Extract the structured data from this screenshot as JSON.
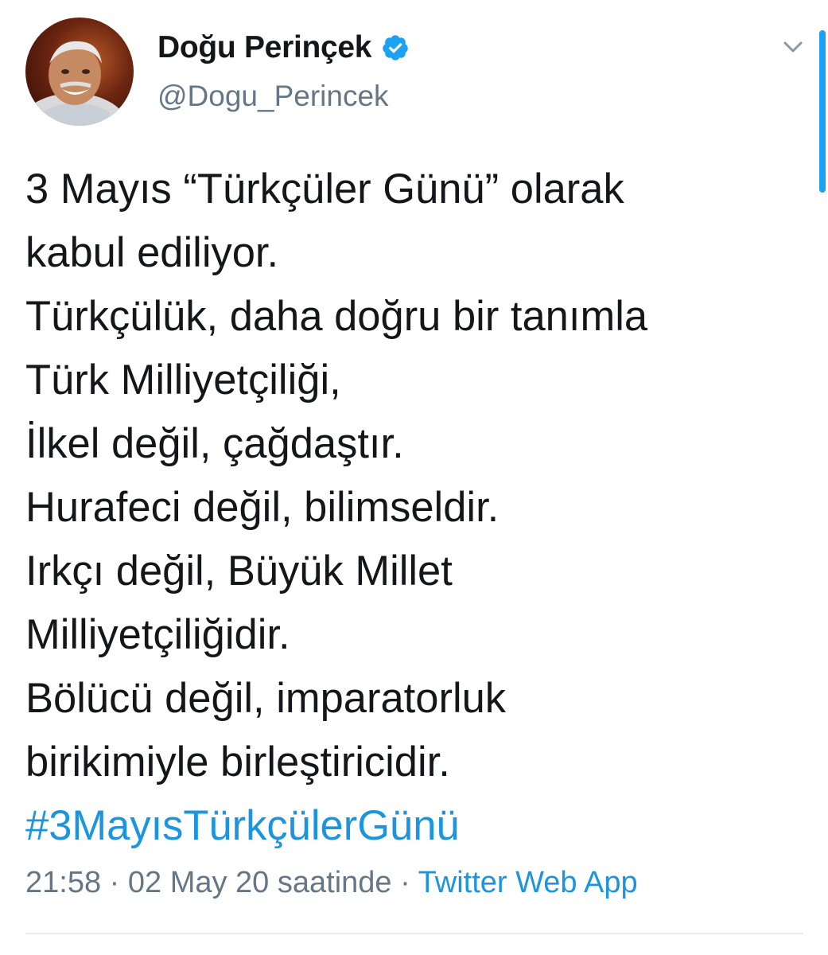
{
  "author": {
    "display_name": "Doğu Perinçek",
    "handle": "@Dogu_Perincek",
    "verified_icon": "verified-badge-icon",
    "avatar_icon": "profile-photo-avatar"
  },
  "tweet": {
    "lines": [
      "3 Mayıs “Türkçüler Günü” olarak",
      "kabul ediliyor.",
      "Türkçülük, daha doğru bir tanımla",
      "Türk Milliyetçiliği,",
      "İlkel değil, çağdaştır.",
      "Hurafeci değil, bilimseldir.",
      "Irkçı değil, Büyük Millet",
      "Milliyetçiliğidir.",
      "Bölücü değil, imparatorluk",
      "birikimiyle birleştiricidir."
    ],
    "hashtag": "#3MayısTürkçülerGünü"
  },
  "meta": {
    "time": "21:58",
    "separator1": " · ",
    "date": "02 May 20 saatinde",
    "separator2": " · ",
    "source": "Twitter Web App"
  },
  "colors": {
    "link": "#1b95e0",
    "secondary_text": "#657786",
    "primary_text": "#14171a",
    "verified": "#1da1f2"
  },
  "icons": {
    "menu": "chevron-down-icon"
  }
}
